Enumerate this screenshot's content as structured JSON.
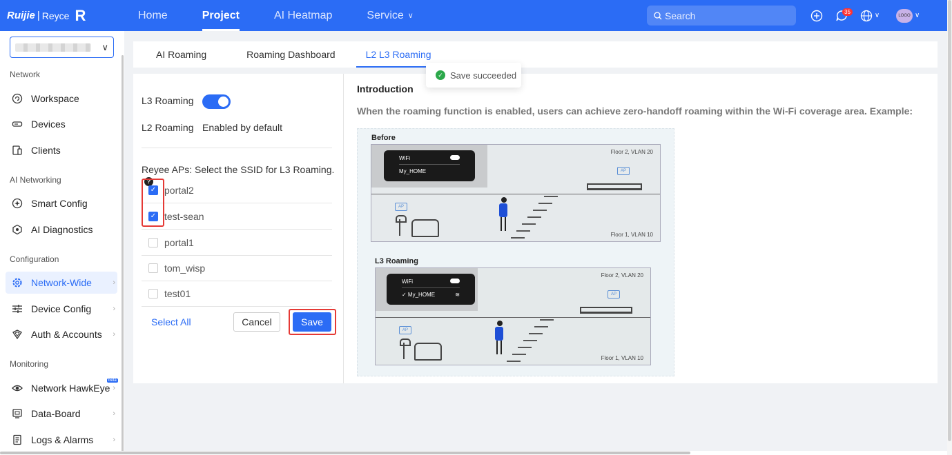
{
  "brand": {
    "ruijie": "Ruijie",
    "separator": "|",
    "reyee": "Reyce",
    "mark": "R"
  },
  "nav": [
    {
      "label": "Home"
    },
    {
      "label": "Project"
    },
    {
      "label": "AI Heatmap"
    },
    {
      "label": "Service"
    }
  ],
  "search": {
    "placeholder": "Search"
  },
  "notifications": {
    "count": "35"
  },
  "avatar": {
    "label": "LOGO"
  },
  "sidebar": {
    "sections": {
      "network": "Network",
      "ai_networking": "AI Networking",
      "configuration": "Configuration",
      "monitoring": "Monitoring"
    },
    "items": [
      {
        "label": "Workspace",
        "icon": "workspace-icon"
      },
      {
        "label": "Devices",
        "icon": "devices-icon"
      },
      {
        "label": "Clients",
        "icon": "clients-icon"
      },
      {
        "label": "Smart Config",
        "icon": "smart-config-icon"
      },
      {
        "label": "AI Diagnostics",
        "icon": "ai-diagnostics-icon"
      },
      {
        "label": "Network-Wide",
        "icon": "gear-icon"
      },
      {
        "label": "Device Config",
        "icon": "sliders-icon"
      },
      {
        "label": "Auth & Accounts",
        "icon": "shield-icon"
      },
      {
        "label": "Network HawkEye",
        "icon": "eye-icon",
        "badge": "beta"
      },
      {
        "label": "Data-Board",
        "icon": "dashboard-icon"
      },
      {
        "label": "Logs & Alarms",
        "icon": "logs-icon"
      }
    ]
  },
  "tabs": [
    {
      "label": "AI Roaming"
    },
    {
      "label": "Roaming Dashboard"
    },
    {
      "label": "L2 L3 Roaming"
    }
  ],
  "toast": {
    "message": "Save succeeded"
  },
  "roaming": {
    "l3_label": "L3 Roaming",
    "l3_enabled": true,
    "l2_label": "L2 Roaming",
    "l2_value": "Enabled by default",
    "ssid_prompt": "Reyee APs: Select the SSID for L3 Roaming.",
    "ssids": [
      {
        "name": "portal2",
        "checked": true
      },
      {
        "name": "test-sean",
        "checked": true
      },
      {
        "name": "portal1",
        "checked": false
      },
      {
        "name": "tom_wisp",
        "checked": false
      },
      {
        "name": "test01",
        "checked": false
      }
    ],
    "select_all": "Select All",
    "cancel": "Cancel",
    "save": "Save"
  },
  "intro": {
    "title": "Introduction",
    "description": "When the roaming function is enabled, users can achieve zero-handoff roaming within the Wi-Fi coverage area. Example:"
  },
  "illustration": {
    "before_label": "Before",
    "after_label": "L3 Roaming",
    "wifi": "WiFi",
    "ssid": "My_HOME",
    "ssid_connected": "✓ My_HOME",
    "floor2": "Floor 2, VLAN 20",
    "floor1": "Floor 1, VLAN 10",
    "ap": "AP"
  },
  "colors": {
    "accent": "#2b6cf5",
    "success": "#2ba84a",
    "highlight": "#e53935"
  }
}
